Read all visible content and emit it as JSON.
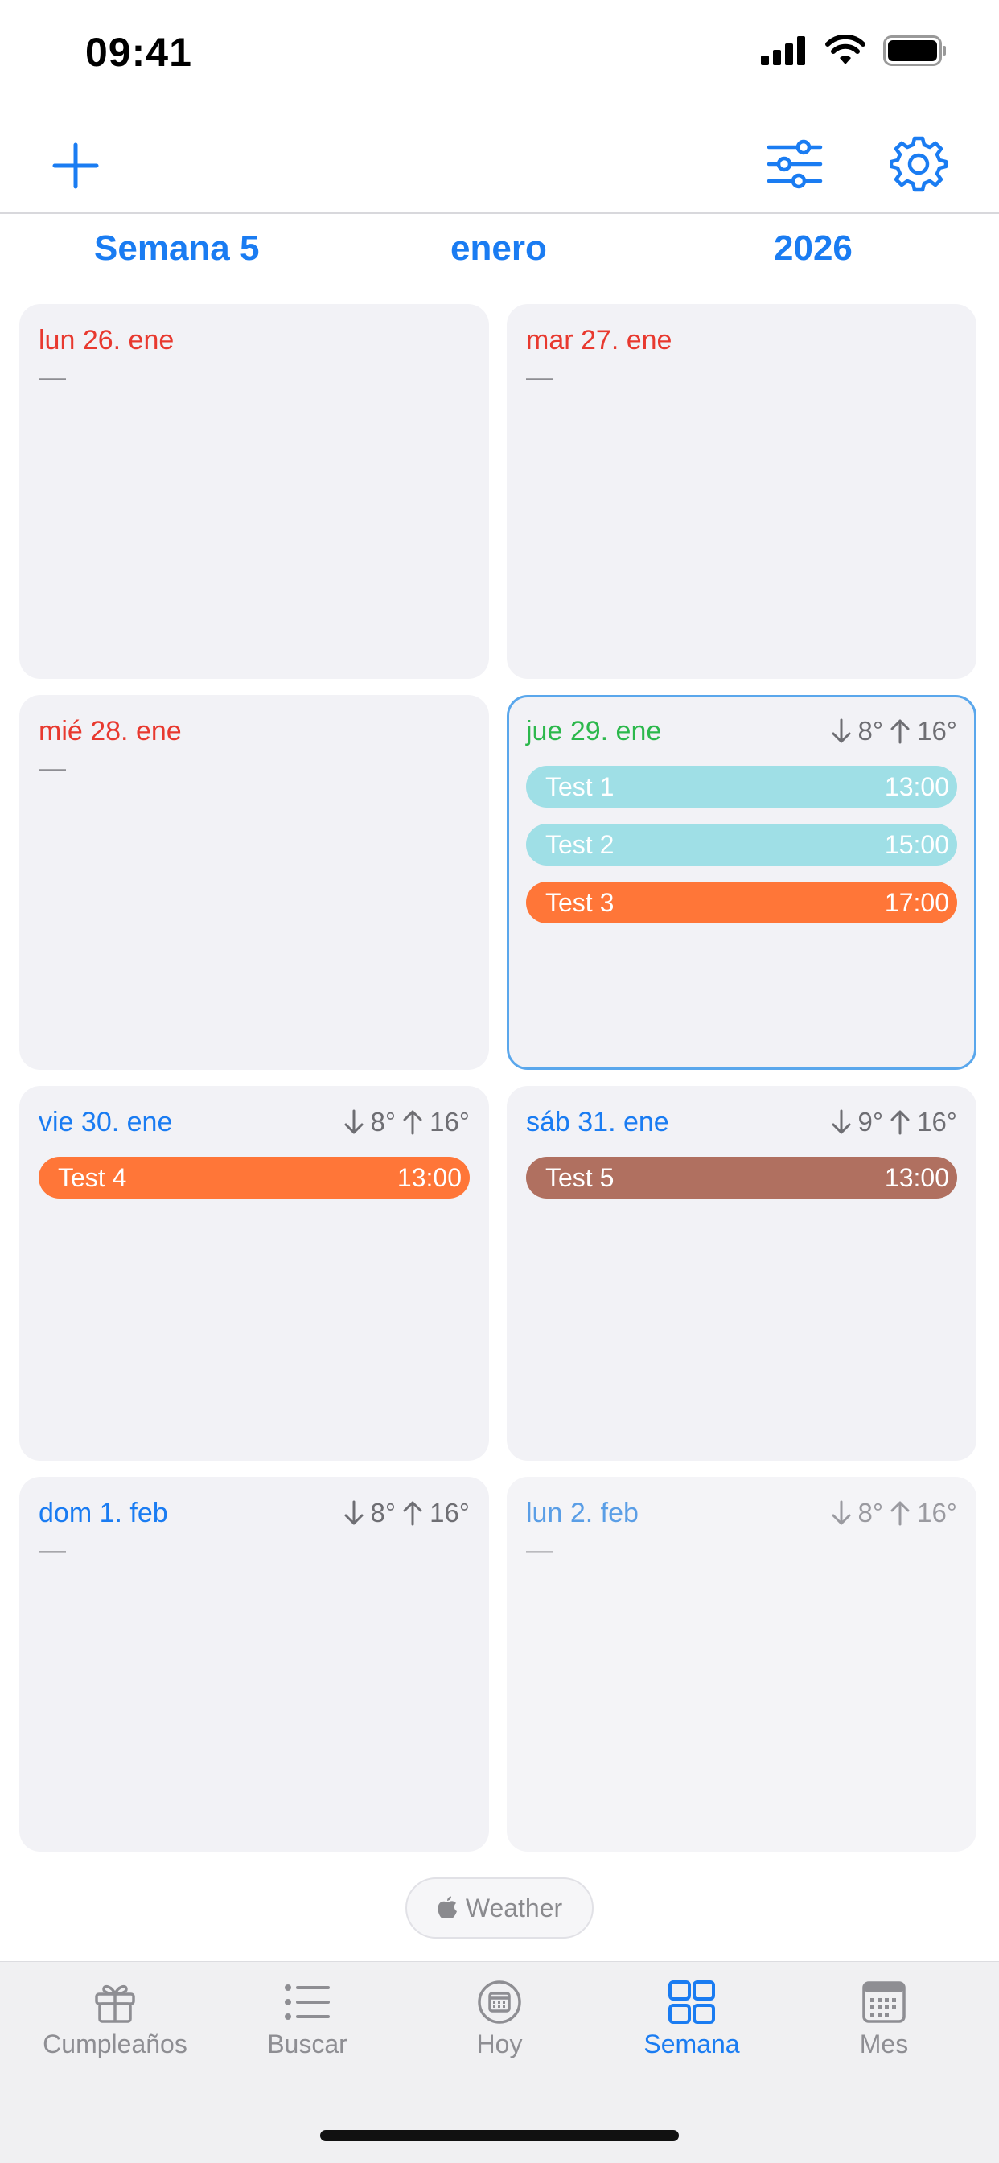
{
  "status": {
    "time": "09:41"
  },
  "header": {
    "week_label": "Semana 5",
    "month_label": "enero",
    "year_label": "2026"
  },
  "colors": {
    "accent": "#1a7cf2",
    "today_green": "#2cb84c",
    "past_red": "#e8392f",
    "event_teal": "#9fdfe6",
    "event_orange": "#ff7638",
    "event_brown": "#b07060"
  },
  "days": [
    {
      "date": "lun 26. ene",
      "placeholder": "—",
      "weather": null,
      "events": []
    },
    {
      "date": "mar 27. ene",
      "placeholder": "—",
      "weather": null,
      "events": []
    },
    {
      "date": "mié 28. ene",
      "placeholder": "—",
      "weather": null,
      "events": []
    },
    {
      "date": "jue 29. ene",
      "placeholder": "",
      "weather": {
        "low": "8°",
        "high": "16°"
      },
      "events": [
        {
          "title": "Test 1",
          "time": "13:00"
        },
        {
          "title": "Test 2",
          "time": "15:00"
        },
        {
          "title": "Test 3",
          "time": "17:00"
        }
      ]
    },
    {
      "date": "vie 30. ene",
      "placeholder": "",
      "weather": {
        "low": "8°",
        "high": "16°"
      },
      "events": [
        {
          "title": "Test 4",
          "time": "13:00"
        }
      ]
    },
    {
      "date": "sáb 31. ene",
      "placeholder": "",
      "weather": {
        "low": "9°",
        "high": "16°"
      },
      "events": [
        {
          "title": "Test 5",
          "time": "13:00"
        }
      ]
    },
    {
      "date": "dom 1. feb",
      "placeholder": "—",
      "weather": {
        "low": "8°",
        "high": "16°"
      },
      "events": []
    },
    {
      "date": "lun 2. feb",
      "placeholder": "—",
      "weather": {
        "low": "8°",
        "high": "16°"
      },
      "events": []
    }
  ],
  "weather_attribution": {
    "label": "Weather"
  },
  "tabs": [
    {
      "label": "Cumpleaños",
      "icon": "gift-icon"
    },
    {
      "label": "Buscar",
      "icon": "list-icon"
    },
    {
      "label": "Hoy",
      "icon": "today-icon"
    },
    {
      "label": "Semana",
      "icon": "week-grid-icon"
    },
    {
      "label": "Mes",
      "icon": "month-calendar-icon"
    }
  ]
}
